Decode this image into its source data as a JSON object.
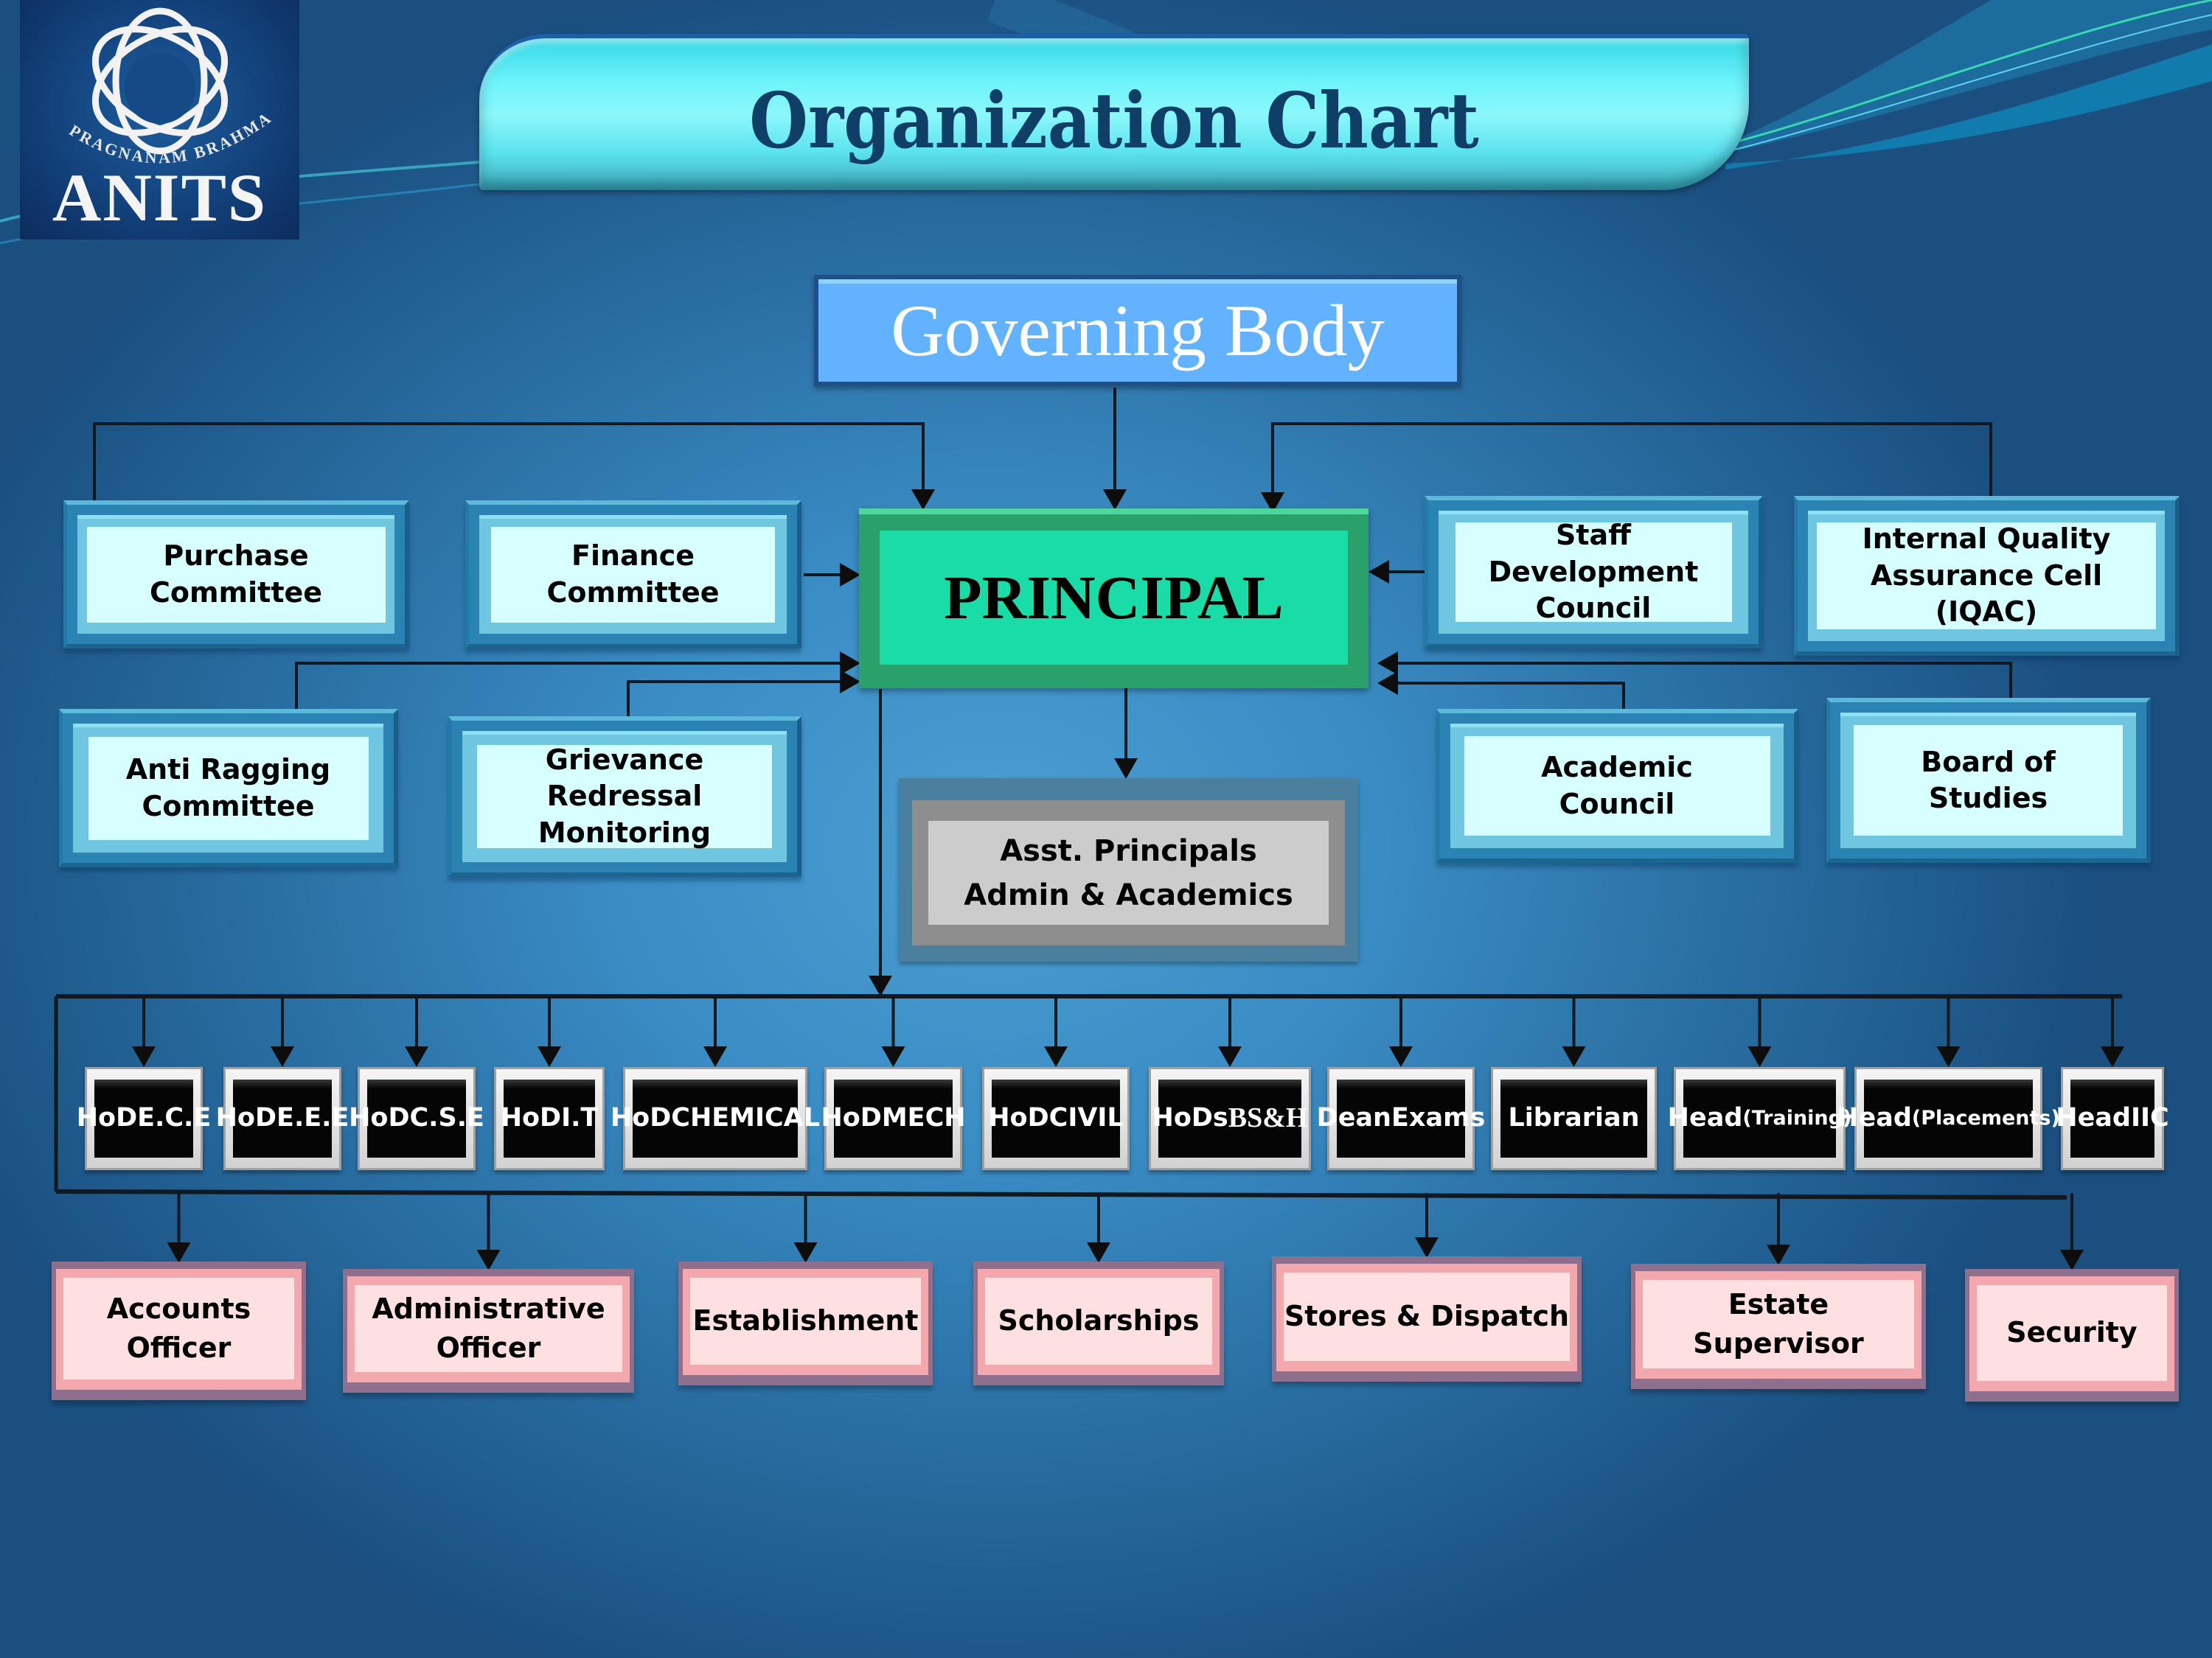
{
  "logo": {
    "name": "ANITS",
    "motto": "PRAGNANAM BRAHMA"
  },
  "title": "Organization Chart",
  "governing_body": "Governing Body",
  "principal": "PRINCIPAL",
  "committees_top_left": [
    {
      "id": "purchase",
      "label": "Purchase\nCommittee"
    },
    {
      "id": "finance",
      "label": "Finance\nCommittee"
    }
  ],
  "committees_top_right": [
    {
      "id": "staff-development",
      "label": "Staff Development\nCouncil"
    },
    {
      "id": "iqac",
      "label": "Internal Quality\nAssurance Cell (IQAC)"
    }
  ],
  "committees_mid_left": [
    {
      "id": "anti-ragging",
      "label": "Anti Ragging\nCommittee"
    },
    {
      "id": "grievance",
      "label": "Grievance Redressal\nMonitoring"
    }
  ],
  "committees_mid_right": [
    {
      "id": "academic-council",
      "label": "Academic\nCouncil"
    },
    {
      "id": "board-of-studies",
      "label": "Board of\nStudies"
    }
  ],
  "asst_principals": "Asst. Principals\nAdmin & Academics",
  "heads": [
    {
      "line1": "HoD",
      "line2": "E.C.E"
    },
    {
      "line1": "HoD",
      "line2": "E.E.E"
    },
    {
      "line1": "HoD",
      "line2": "C.S.E"
    },
    {
      "line1": "HoD",
      "line2": "I.T"
    },
    {
      "line1": "HoD",
      "line2": "CHEMICAL"
    },
    {
      "line1": "HoD",
      "line2": "MECH"
    },
    {
      "line1": "HoD",
      "line2": "CIVIL"
    },
    {
      "line1": "HoDs",
      "line2": "BS&H"
    },
    {
      "line1": "Dean",
      "line2": "Exams"
    },
    {
      "line1": "Librarian",
      "line2": ""
    },
    {
      "line1": "Head",
      "line2": "(Training)"
    },
    {
      "line1": "Head",
      "line2": "(Placements)"
    },
    {
      "line1": "Head",
      "line2": "IIC"
    }
  ],
  "admin_units": [
    "Accounts\nOfficer",
    "Administrative\nOfficer",
    "Establishment",
    "Scholarships",
    "Stores & Dispatch",
    "Estate Supervisor",
    "Security"
  ],
  "colors": {
    "title_text": "#0f3e66",
    "governing_body": "#63b2ff",
    "principal": "#19dca6",
    "committee_fill": "#d7ffff",
    "hod_fill": "#050505",
    "admin_fill": "#ffe0e1",
    "asst_fill": "#cccccc"
  }
}
